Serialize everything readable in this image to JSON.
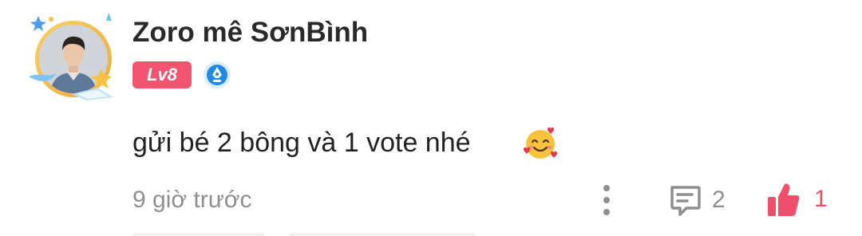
{
  "comment": {
    "author": {
      "name": "Zoro mê SơnBình",
      "level_label": "Lv8",
      "avatar_icon": "avatar-with-star-frame",
      "badge_icon": "pen-nib-badge-icon",
      "level_color": "#f2546f"
    },
    "text": "gửi bé 2 bông và 1 vote nhé",
    "emoji_icon": "smiling-face-with-hearts-icon",
    "timestamp": "9 giờ trước",
    "reply_count": "2",
    "like_count": "1",
    "accent_color": "#ef4f6a"
  }
}
